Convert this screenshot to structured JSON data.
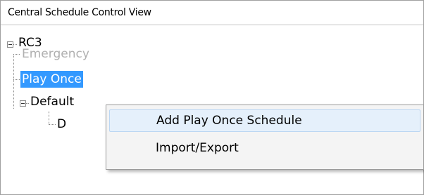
{
  "panel": {
    "title": "Central Schedule Control View"
  },
  "tree": {
    "root": {
      "label": "RC3",
      "expanded": true
    },
    "items": [
      {
        "label": "Emergency",
        "state": "disabled"
      },
      {
        "label": "Play Once",
        "state": "selected"
      },
      {
        "label": "Default",
        "state": "expanded"
      },
      {
        "label": "D",
        "state": "child"
      }
    ]
  },
  "context_menu": {
    "items": [
      {
        "label": "Add Play Once Schedule",
        "highlighted": true
      },
      {
        "label": "Import/Export",
        "highlighted": false
      }
    ]
  },
  "colors": {
    "selection": "#3399ff",
    "disabled_text": "#b0b0b0",
    "menu_hover": "#e5f0fb"
  }
}
